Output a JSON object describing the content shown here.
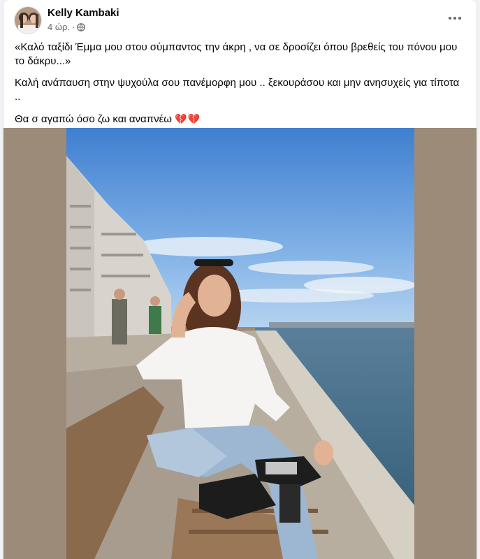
{
  "post": {
    "author": "Kelly Kambaki",
    "time": "4 ώρ.",
    "separator": "·",
    "privacy_icon": "globe-icon",
    "more_icon": "more-options-icon",
    "paragraphs": [
      "«Καλό ταξίδι Έμμα μου στου σύμπαντος την άκρη , να σε δροσίζει όπου βρεθείς του πόνου μου το δάκρυ...»",
      "Καλή ανάπαυση στην ψυχούλα σου πανέμορφη μου .. ξεκουράσου και μην ανησυχείς για τίποτα ..",
      "Θα σ αγαπώ όσο ζω και αναπνέω"
    ],
    "hearts": "💔💔"
  },
  "colors": {
    "media_background": "#9c8b79",
    "author_text": "#050505",
    "meta_text": "#65676b",
    "heart": "#e41e3f"
  }
}
